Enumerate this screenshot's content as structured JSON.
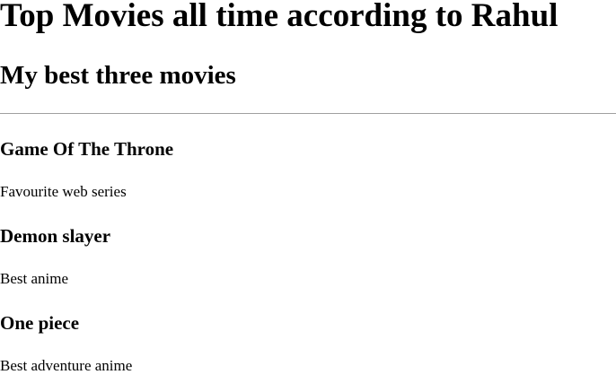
{
  "heading": "Top Movies all time according to Rahul",
  "subheading": "My best three movies",
  "movies": [
    {
      "title": "Game Of The Throne",
      "description": "Favourite web series"
    },
    {
      "title": "Demon slayer",
      "description": "Best anime"
    },
    {
      "title": "One piece",
      "description": "Best adventure anime"
    }
  ]
}
